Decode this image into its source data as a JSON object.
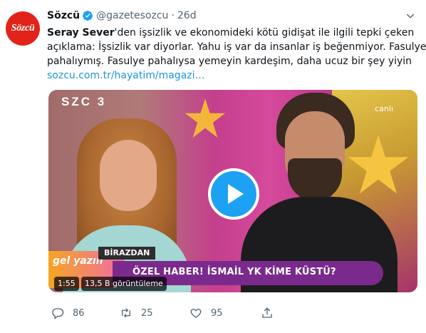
{
  "tweet": {
    "author_name": "Sözcü",
    "handle": "@gazetesozcu",
    "separator": "·",
    "time": "26d",
    "avatar_text": "Sözcü",
    "text": {
      "line1_bold": "Seray Sever",
      "line1_rest": "'den işsizlik ve ekonomideki kötü gidişat ile ilgili tepki çeken",
      "line2": "açıklama: İşsizlik var diyorlar. Yahu iş var da insanlar iş beğenmiyor. Fasulye",
      "line3": "pahalıymış. Fasulye pahalıysa yemeyin kardeşim, daha ucuz bir şey yiyin",
      "link": "sozcu.com.tr/hayatim/magazi…"
    }
  },
  "media": {
    "channel_logo": "SZC",
    "channel_logo_line2": "3",
    "live_label": "canlı",
    "birazdan": "BİRAZDAN",
    "show_logo": "gel yazın",
    "banner_text": "ÖZEL HABER! İSMAİL YK KİME KÜSTÜ?",
    "duration": "1:55",
    "views": "13,5 B görüntüleme",
    "play_icon": "play-icon"
  },
  "actions": {
    "replies": "86",
    "retweets": "25",
    "likes": "95"
  },
  "colors": {
    "verified": "#1da1f2",
    "link": "#1b95e0",
    "brand_red": "#e2231a",
    "muted": "#536471"
  }
}
